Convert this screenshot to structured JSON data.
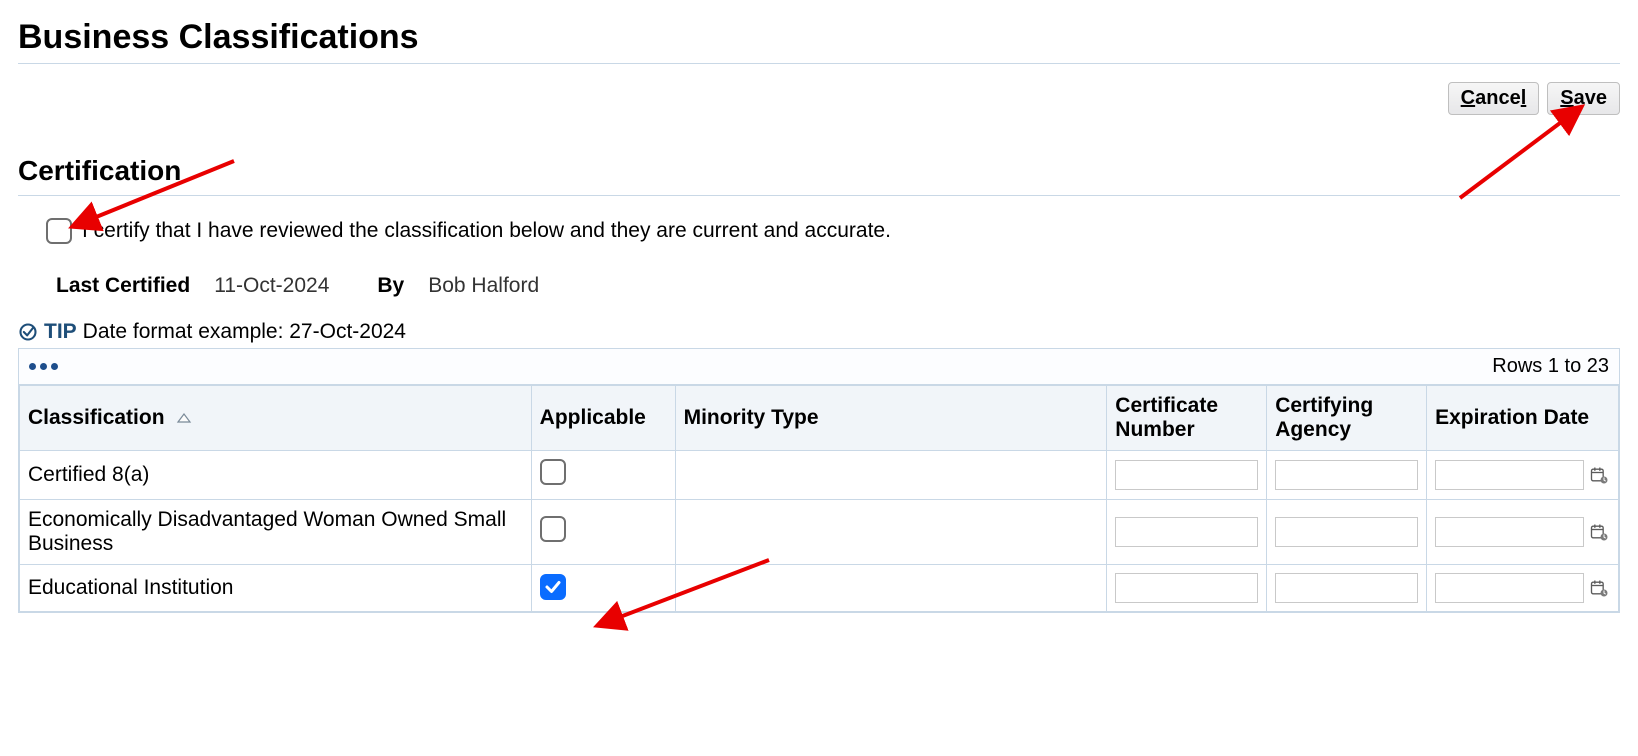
{
  "page": {
    "title": "Business Classifications"
  },
  "actions": {
    "cancel_label": "Cancel",
    "save_label": "Save"
  },
  "certification": {
    "heading": "Certification",
    "certify_text": "I certify that I have reviewed the classification below and they are current and accurate.",
    "certify_checked": false,
    "last_certified_label": "Last Certified",
    "last_certified_value": "11-Oct-2024",
    "by_label": "By",
    "by_value": "Bob Halford"
  },
  "tip": {
    "word": "TIP",
    "text": "Date format example: 27-Oct-2024"
  },
  "table": {
    "rows_summary": "Rows 1 to 23",
    "headers": {
      "classification": "Classification",
      "applicable": "Applicable",
      "minority_type": "Minority Type",
      "certificate_number": "Certificate Number",
      "certifying_agency": "Certifying Agency",
      "expiration_date": "Expiration Date"
    },
    "rows": [
      {
        "classification": "Certified 8(a)",
        "applicable": false,
        "minority_type": "",
        "certificate_number": "",
        "certifying_agency": "",
        "expiration_date": ""
      },
      {
        "classification": "Economically Disadvantaged Woman Owned Small Business",
        "applicable": false,
        "minority_type": "",
        "certificate_number": "",
        "certifying_agency": "",
        "expiration_date": ""
      },
      {
        "classification": "Educational Institution",
        "applicable": true,
        "minority_type": "",
        "certificate_number": "",
        "certifying_agency": "",
        "expiration_date": ""
      }
    ]
  }
}
